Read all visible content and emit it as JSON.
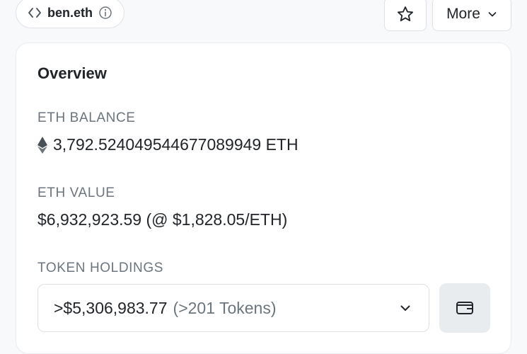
{
  "header": {
    "ens_name": "ben.eth",
    "more_label": "More"
  },
  "overview": {
    "title": "Overview",
    "eth_balance_label": "ETH BALANCE",
    "eth_balance_value": "3,792.524049544677089949 ETH",
    "eth_value_label": "ETH VALUE",
    "eth_value_value": "$6,932,923.59 (@ $1,828.05/ETH)",
    "token_holdings_label": "TOKEN HOLDINGS",
    "token_holdings_amount": ">$5,306,983.77",
    "token_holdings_count": "(>201 Tokens)"
  },
  "icons": {
    "code": "code-icon",
    "info": "info-icon",
    "star": "star-icon",
    "chevron": "chevron-down-icon",
    "eth": "ethereum-icon",
    "wallet": "wallet-icon"
  },
  "colors": {
    "text": "#212529",
    "muted": "#6c757d",
    "border": "#dee2e6",
    "button_bg": "#e9ecef"
  }
}
